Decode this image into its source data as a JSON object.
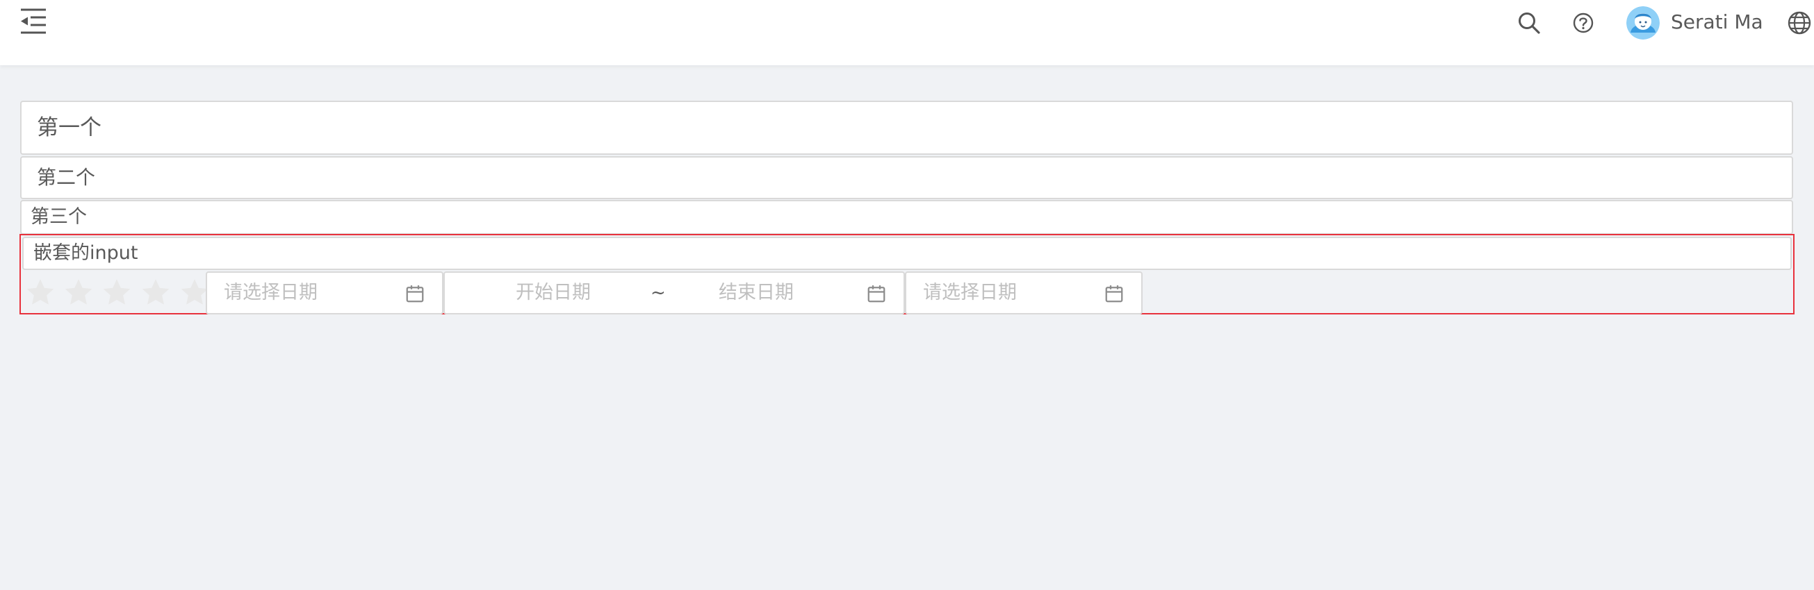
{
  "header": {
    "menu_icon": "indent-menu-icon",
    "search_icon": "search-icon",
    "help_icon": "question-circle-icon",
    "user_name": "Serati Ma",
    "language_icon": "globe-icon"
  },
  "form": {
    "input_1_value": "第一个",
    "input_2_value": "第二个",
    "input_3_value": "第三个",
    "nested_input_value": "嵌套的input",
    "rating": {
      "max": 5,
      "value": 0
    },
    "date_picker_1": {
      "placeholder": "请选择日期"
    },
    "range_picker": {
      "start_placeholder": "开始日期",
      "separator": "~",
      "end_placeholder": "结束日期"
    },
    "date_picker_2": {
      "placeholder": "请选择日期"
    }
  },
  "colors": {
    "header_bg": "#ffffff",
    "page_bg": "#f0f2f5",
    "border": "#d9d9d9",
    "highlight_border": "#e8323c",
    "star_inactive": "#e8e8e8",
    "placeholder": "#bfbfbf"
  }
}
